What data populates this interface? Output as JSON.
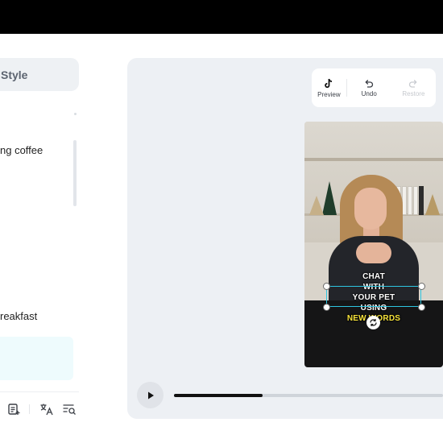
{
  "sidebar": {
    "style_tab_label": "Style",
    "lines": [
      "ng coffee",
      "reakfast"
    ],
    "tool_icons": [
      "document-list-icon",
      "translate-icon",
      "search-list-icon"
    ]
  },
  "toolbar": {
    "preview_label": "Preview",
    "undo_label": "Undo",
    "restore_label": "Restore"
  },
  "video": {
    "caption": {
      "lines": [
        "CHAT",
        "WITH",
        "YOUR PET",
        "USING"
      ],
      "highlight_line": "NEW WORDS",
      "highlight_color": "#f7e33a"
    }
  },
  "player": {
    "progress": 0.33
  },
  "colors": {
    "top_bar": "#000000",
    "panel_bg": "#edf0f4",
    "selection": "#2ec5e0",
    "active_row": "#eefbfd"
  }
}
